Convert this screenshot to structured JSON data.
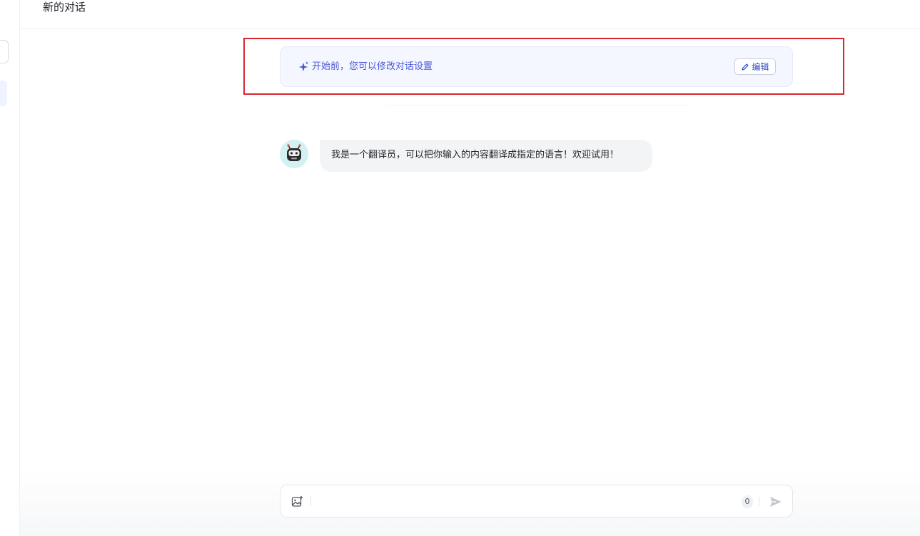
{
  "header": {
    "title": "新的对话"
  },
  "settings_banner": {
    "text": "开始前，您可以修改对话设置",
    "edit_label": "编辑",
    "icon": "sparkle-icon"
  },
  "messages": [
    {
      "role": "assistant",
      "avatar": "robot-avatar",
      "text": "我是一个翻译员，可以把你输入的内容翻译成指定的语言！欢迎试用！"
    }
  ],
  "composer": {
    "value": "",
    "placeholder": "",
    "char_count": "0",
    "image_icon": "image-upload-icon",
    "send_icon": "send-icon"
  },
  "colors": {
    "accent": "#4a55d8",
    "highlight_border": "#d8262f",
    "banner_bg": "#f4f7ff",
    "bubble_bg": "#f3f4f6"
  }
}
